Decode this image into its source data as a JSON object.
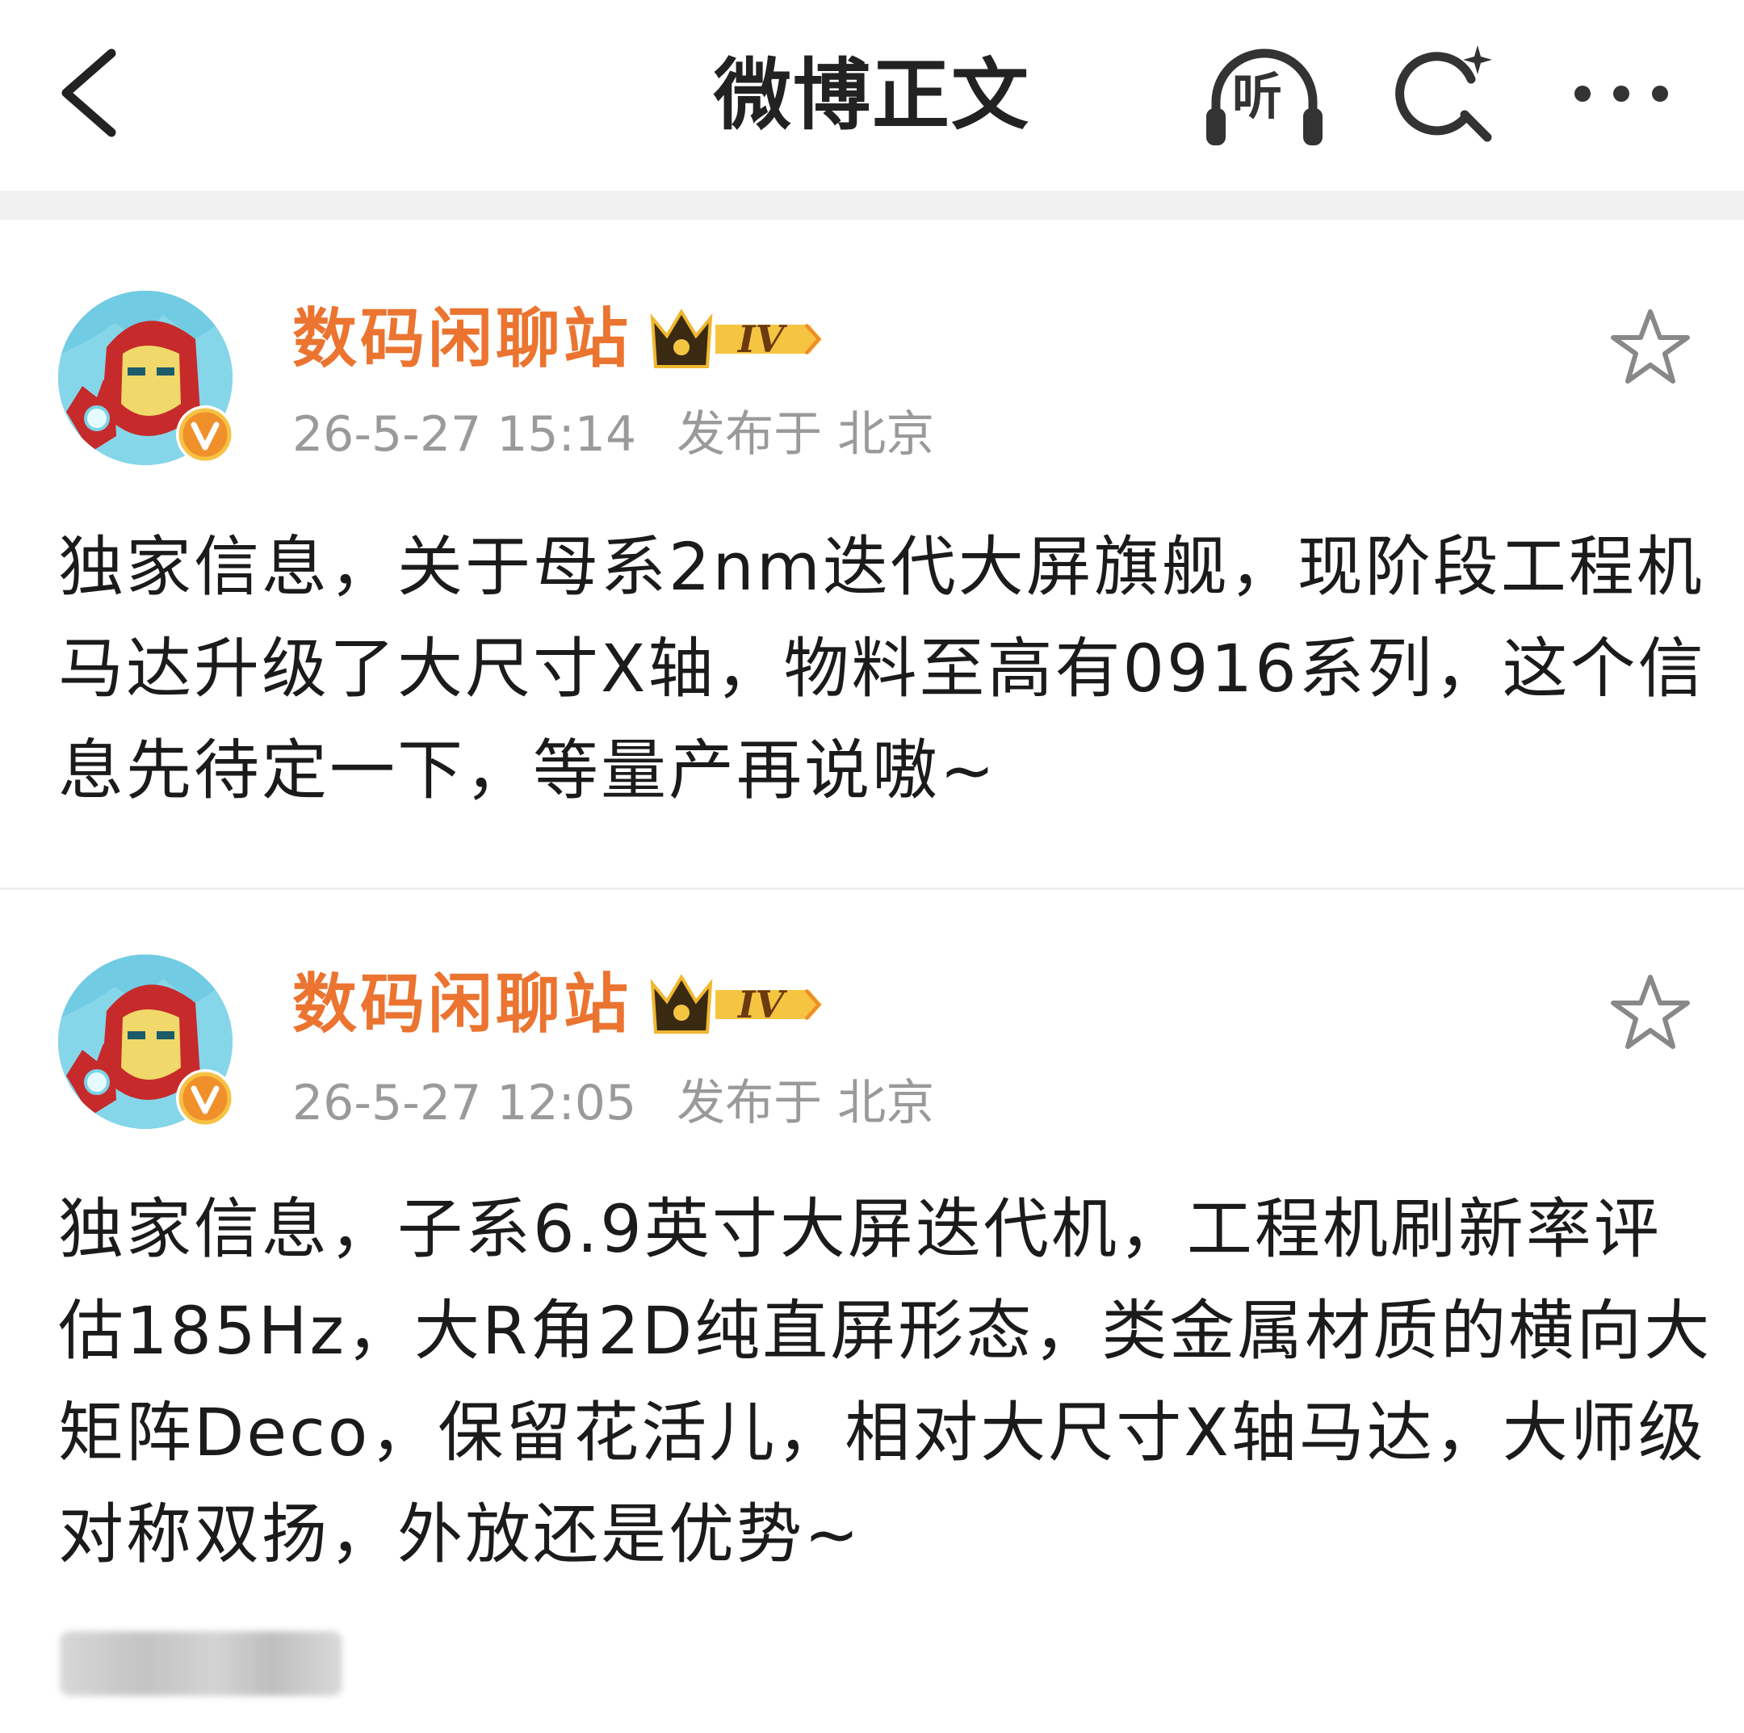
{
  "header": {
    "title": "微博正文",
    "listen_label": "听",
    "icons": [
      "chevron-left-icon",
      "headphones-icon",
      "ai-search-icon",
      "more-icon"
    ]
  },
  "posts": [
    {
      "username": "数码闲聊站",
      "level": "IV",
      "time": "26-5-27 15:14",
      "location": "发布于 北京",
      "lines": [
        "独家信息，关于母系2nm迭代大屏旗舰，现阶段工程机",
        "马达升级了大尺寸X轴，物料至高有0916系列，这个信",
        "息先待定一下，等量产再说嗷~"
      ]
    },
    {
      "username": "数码闲聊站",
      "level": "IV",
      "time": "26-5-27 12:05",
      "location": "发布于 北京",
      "lines": [
        "独家信息，子系6.9英寸大屏迭代机，工程机刷新率评",
        "估185Hz，大R角2D纯直屏形态，类金属材质的横向大",
        "矩阵Deco，保留花活儿，相对大尺寸X轴马达，大师级",
        "对称双扬，外放还是优势~"
      ]
    }
  ],
  "colors": {
    "username": "#eb7430",
    "meta": "#9a9a9a",
    "separator": "#f0f0f0",
    "badge_gold": "#f5c542",
    "verified": "#f0902a"
  }
}
